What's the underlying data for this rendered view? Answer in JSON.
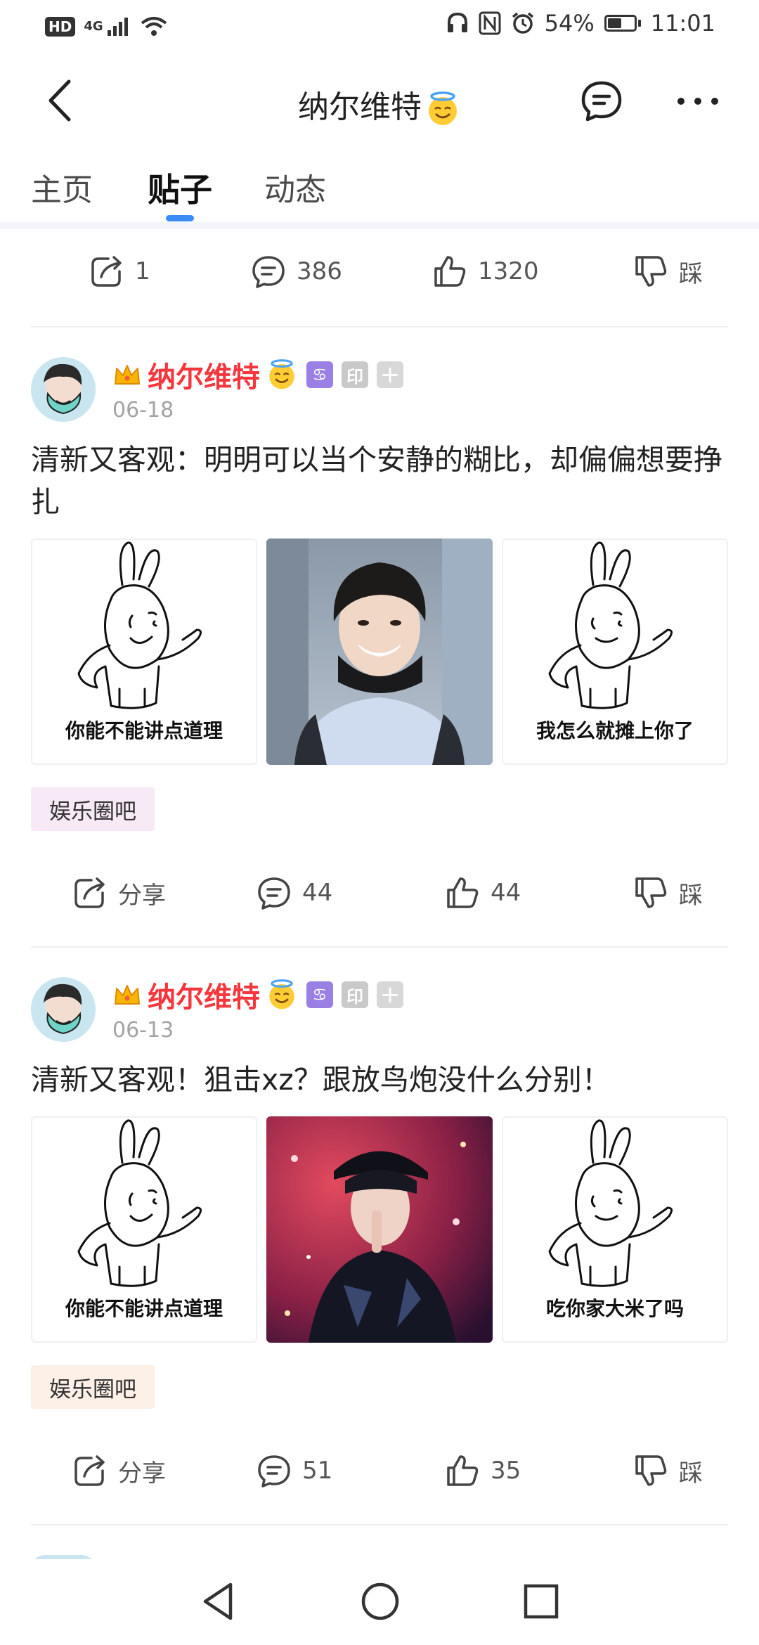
{
  "status_bar": {
    "hd": "HD",
    "network": "4G",
    "battery_percent": "54%",
    "battery_level": 0.54,
    "time": "11:01"
  },
  "nav": {
    "title": "纳尔维特",
    "title_emoji": "smiling-halo-emoji",
    "back_icon": "chevron-left-icon",
    "message_icon": "chat-bubble-icon",
    "more_icon": "more-dots-icon"
  },
  "tabs": [
    {
      "label": "主页",
      "active": false
    },
    {
      "label": "贴子",
      "active": true
    },
    {
      "label": "动态",
      "active": false
    }
  ],
  "top_actions": {
    "share_count": "1",
    "comment_count": "386",
    "like_count": "1320",
    "dislike_label": "踩"
  },
  "posts": [
    {
      "author": "纳尔维特",
      "date": "06-18",
      "badges": {
        "zodiac": "♋",
        "stamp": "印",
        "plus": "+"
      },
      "text": "清新又客观：明明可以当个安静的糊比，却偏偏想要挣扎",
      "images": [
        {
          "type": "sticker",
          "caption": "你能不能讲点道理"
        },
        {
          "type": "photo",
          "caption": ""
        },
        {
          "type": "sticker",
          "caption": "我怎么就摊上你了"
        }
      ],
      "tag": "娱乐圈吧",
      "tag_bg": "#f8e9f7",
      "actions": {
        "share": "分享",
        "comments": "44",
        "likes": "44",
        "dislike": "踩"
      }
    },
    {
      "author": "纳尔维特",
      "date": "06-13",
      "badges": {
        "zodiac": "♋",
        "stamp": "印",
        "plus": "+"
      },
      "text": "清新又客观！狙击xz？跟放鸟炮没什么分别！",
      "images": [
        {
          "type": "sticker",
          "caption": "你能不能讲点道理"
        },
        {
          "type": "photo",
          "caption": ""
        },
        {
          "type": "sticker",
          "caption": "吃你家大米了吗"
        }
      ],
      "tag": "娱乐圈吧",
      "tag_bg": "#fdf0e6",
      "actions": {
        "share": "分享",
        "comments": "51",
        "likes": "35",
        "dislike": "踩"
      }
    }
  ],
  "colors": {
    "accent": "#3b8cf5",
    "author_name": "#f5373d",
    "zodiac_badge": "#9a7fe4"
  }
}
